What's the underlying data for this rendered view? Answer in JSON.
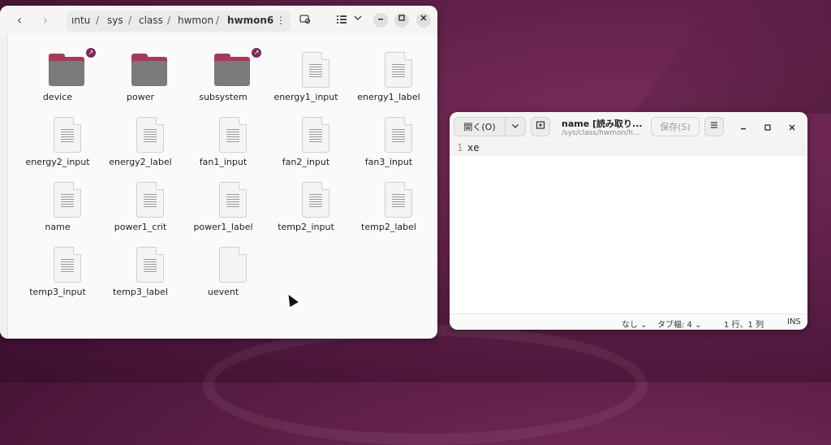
{
  "file_manager": {
    "path": [
      "ıntu",
      "sys",
      "class",
      "hwmon",
      "hwmon6"
    ],
    "separators": [
      "/",
      "/",
      "/",
      "/"
    ],
    "nav": {
      "back": "‹",
      "forward": "›"
    },
    "items": [
      {
        "label": "device",
        "kind": "folder-link"
      },
      {
        "label": "power",
        "kind": "folder"
      },
      {
        "label": "subsystem",
        "kind": "folder-link"
      },
      {
        "label": "energy1_input",
        "kind": "file"
      },
      {
        "label": "energy1_label",
        "kind": "file"
      },
      {
        "label": "energy2_input",
        "kind": "file"
      },
      {
        "label": "energy2_label",
        "kind": "file"
      },
      {
        "label": "fan1_input",
        "kind": "file"
      },
      {
        "label": "fan2_input",
        "kind": "file"
      },
      {
        "label": "fan3_input",
        "kind": "file"
      },
      {
        "label": "name",
        "kind": "file"
      },
      {
        "label": "power1_crit",
        "kind": "file"
      },
      {
        "label": "power1_label",
        "kind": "file"
      },
      {
        "label": "temp2_input",
        "kind": "file"
      },
      {
        "label": "temp2_label",
        "kind": "file"
      },
      {
        "label": "temp3_input",
        "kind": "file"
      },
      {
        "label": "temp3_label",
        "kind": "file"
      },
      {
        "label": "uevent",
        "kind": "file-empty"
      }
    ],
    "icons": [
      "chevron-left-icon",
      "chevron-right-icon",
      "menu-dots-icon",
      "camera-search-icon",
      "list-view-icon",
      "chevron-down-icon",
      "minimize-icon",
      "maximize-icon",
      "close-icon",
      "link-badge-icon"
    ]
  },
  "editor": {
    "open_label": "開く(O)",
    "title": "name [読み取り...",
    "subtitle": "/sys/class/hwmon/h...",
    "save_label": "保存(S)",
    "line_number": "1",
    "content": "xe",
    "status": {
      "lang": "なし ⌄",
      "tab": "タブ幅: 4 ⌄",
      "position": "1 行、1 列",
      "mode": "INS"
    }
  },
  "colors": {
    "accent": "#7a2d5b",
    "folder_tab": "#a63b5a",
    "folder_body": "#7b7b7b"
  }
}
